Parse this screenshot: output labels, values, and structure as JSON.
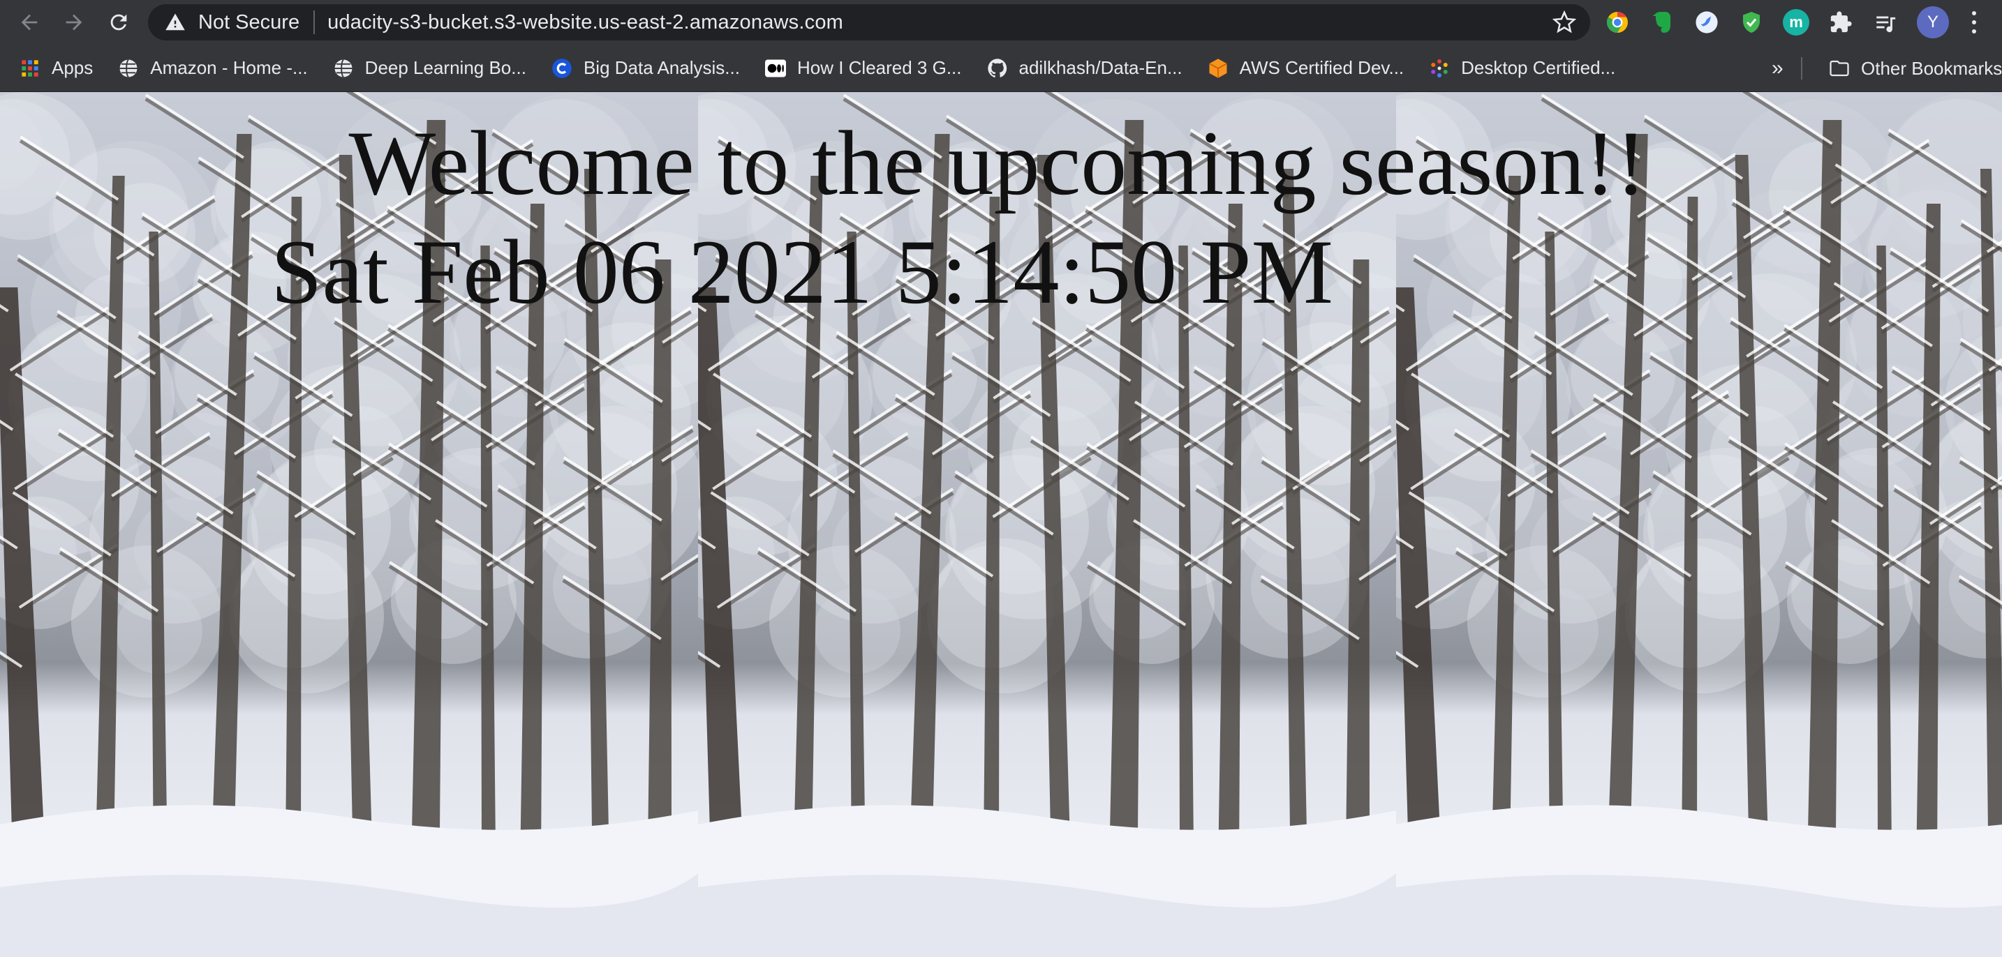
{
  "browser": {
    "security_label": "Not Secure",
    "url": "udacity-s3-bucket.s3-website.us-east-2.amazonaws.com",
    "profile_initial": "Y",
    "extensions": [
      "chrome-color-icon",
      "evernote-icon",
      "blue-bird-icon",
      "shield-check-icon",
      "m-icon",
      "puzzle-icon",
      "reading-list-icon"
    ],
    "extension_m_letter": "m"
  },
  "bookmarks": {
    "items": [
      {
        "label": "Apps",
        "icon": "apps-grid-icon"
      },
      {
        "label": "Amazon - Home -...",
        "icon": "globe-icon"
      },
      {
        "label": "Deep Learning Bo...",
        "icon": "globe-icon"
      },
      {
        "label": "Big Data Analysis...",
        "icon": "c-logo-icon"
      },
      {
        "label": "How I Cleared 3 G...",
        "icon": "medium-icon"
      },
      {
        "label": "adilkhash/Data-En...",
        "icon": "github-icon"
      },
      {
        "label": "AWS Certified Dev...",
        "icon": "aws-cube-icon"
      },
      {
        "label": "Desktop Certified...",
        "icon": "dots-logo-icon"
      }
    ],
    "more_label": "»",
    "other_label": "Other Bookmarks"
  },
  "page": {
    "heading": "Welcome to the upcoming season!!",
    "datetime": "Sat Feb 06 2021 5:14:50 PM"
  }
}
